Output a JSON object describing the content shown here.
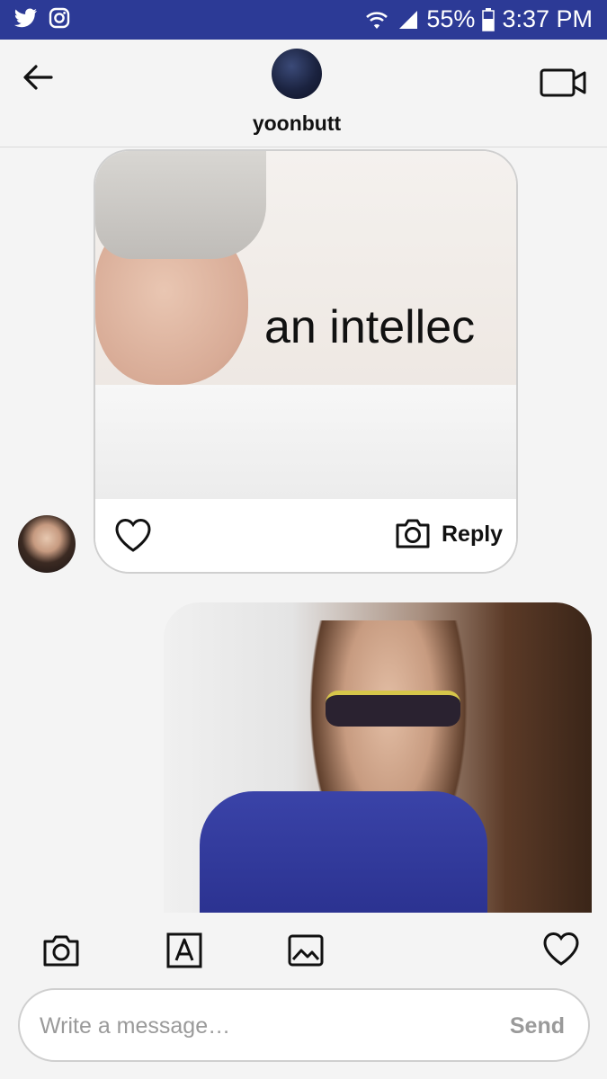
{
  "status_bar": {
    "left_icons": [
      "twitter-icon",
      "instagram-icon"
    ],
    "battery_percent": "55%",
    "time": "3:37 PM"
  },
  "header": {
    "username": "yoonbutt"
  },
  "messages": [
    {
      "type": "image",
      "image_caption": "an intellec",
      "actions": {
        "reply_label": "Reply"
      }
    },
    {
      "type": "image"
    }
  ],
  "composer": {
    "placeholder": "Write a message…",
    "send_label": "Send"
  },
  "colors": {
    "status_bar_bg": "#2c3a96",
    "background": "#f4f4f4",
    "accent_text": "#111111",
    "muted_text": "#9a9a9a"
  }
}
